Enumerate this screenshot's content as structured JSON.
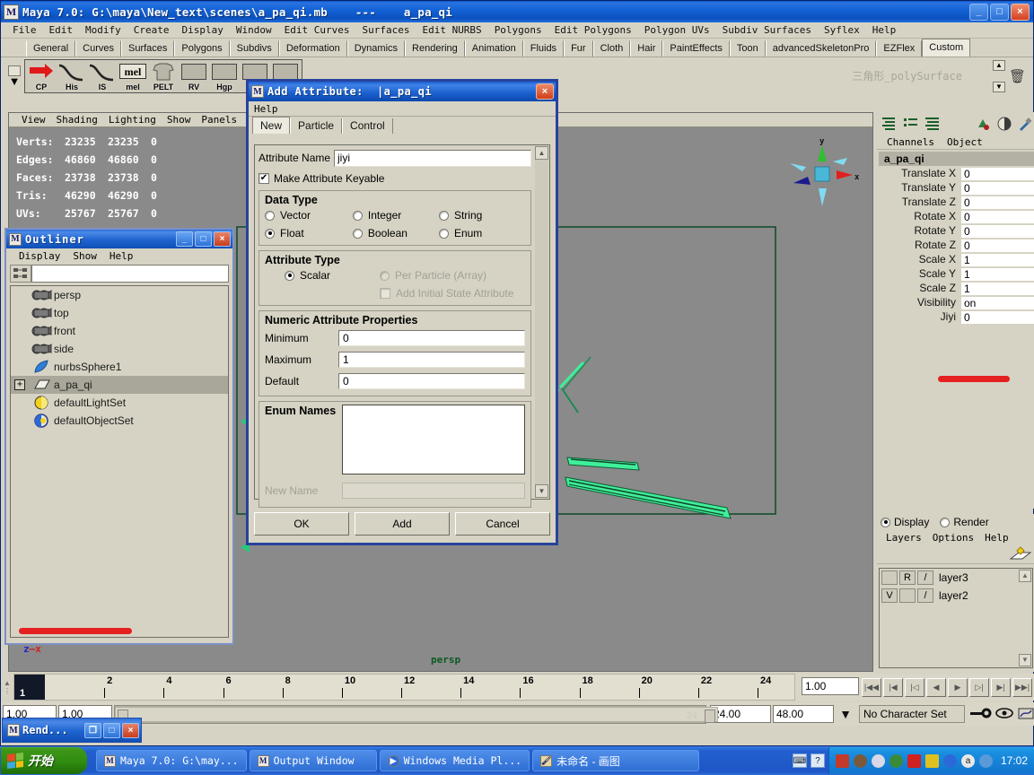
{
  "window": {
    "title": "Maya 7.0: G:\\maya\\New_text\\scenes\\a_pa_qi.mb    ---    a_pa_qi",
    "icon": "maya-m-icon",
    "minimize": "_",
    "maximize": "□",
    "close": "×"
  },
  "menubar": {
    "items": [
      "File",
      "Edit",
      "Modify",
      "Create",
      "Display",
      "Window",
      "Edit Curves",
      "Surfaces",
      "Edit NURBS",
      "Polygons",
      "Edit Polygons",
      "Polygon UVs",
      "Subdiv Surfaces",
      "Syflex",
      "Help"
    ]
  },
  "shelf": {
    "tabs": [
      "General",
      "Curves",
      "Surfaces",
      "Polygons",
      "Subdivs",
      "Deformation",
      "Dynamics",
      "Rendering",
      "Animation",
      "Fluids",
      "Fur",
      "Cloth",
      "Hair",
      "PaintEffects",
      "Toon",
      "advancedSkeletonPro",
      "EZFlex",
      "Custom"
    ],
    "active_tab": "Custom",
    "buttons": [
      {
        "label": "CP",
        "icon": "red-arrow-icon"
      },
      {
        "label": "His",
        "icon": "curve-icon"
      },
      {
        "label": "IS",
        "icon": "curve-icon"
      },
      {
        "label": "mel",
        "icon": "mel-script-icon"
      },
      {
        "label": "PELT",
        "icon": "shirt-icon"
      },
      {
        "label": "RV",
        "icon": "blank-icon"
      },
      {
        "label": "Hgp",
        "icon": "blank-icon"
      },
      {
        "label": "",
        "icon": "blank-icon"
      },
      {
        "label": "",
        "icon": "blank-icon"
      }
    ],
    "trash_icon": "trash-icon",
    "scroll_up": "▲",
    "scroll_down": "▼"
  },
  "viewport": {
    "menu": [
      "View",
      "Shading",
      "Lighting",
      "Show",
      "Panels"
    ],
    "camera_label": "persp",
    "axis_labels": {
      "x": "x",
      "y": "y",
      "z": "z"
    },
    "hud": {
      "rows": [
        {
          "label": "Verts:",
          "total": "23235",
          "selected": "23235",
          "extra": "0"
        },
        {
          "label": "Edges:",
          "total": "46860",
          "selected": "46860",
          "extra": "0"
        },
        {
          "label": "Faces:",
          "total": "23738",
          "selected": "23738",
          "extra": "0"
        },
        {
          "label": "Tris:",
          "total": "46290",
          "selected": "46290",
          "extra": "0"
        },
        {
          "label": "UVs:",
          "total": "25767",
          "selected": "25767",
          "extra": "0"
        }
      ]
    }
  },
  "outliner": {
    "title": "Outliner",
    "icon": "maya-m-icon",
    "minimize": "_",
    "maximize": "□",
    "close": "×",
    "menu": [
      "Display",
      "Show",
      "Help"
    ],
    "search_value": "",
    "items": [
      {
        "label": "persp",
        "icon": "camera-icon",
        "selected": false,
        "expandable": false
      },
      {
        "label": "top",
        "icon": "camera-icon",
        "selected": false,
        "expandable": false
      },
      {
        "label": "front",
        "icon": "camera-icon",
        "selected": false,
        "expandable": false
      },
      {
        "label": "side",
        "icon": "camera-icon",
        "selected": false,
        "expandable": false
      },
      {
        "label": "nurbsSphere1",
        "icon": "nurbs-surface-icon",
        "selected": false,
        "expandable": false
      },
      {
        "label": "a_pa_qi",
        "icon": "mesh-icon",
        "selected": true,
        "expandable": true,
        "expand_glyph": "+"
      },
      {
        "label": "defaultLightSet",
        "icon": "light-set-icon",
        "selected": false,
        "expandable": false
      },
      {
        "label": "defaultObjectSet",
        "icon": "object-set-icon",
        "selected": false,
        "expandable": false
      }
    ]
  },
  "channel_box": {
    "menu": [
      "Channels",
      "Object"
    ],
    "object_name": "a_pa_qi",
    "channels": [
      {
        "name": "Translate X",
        "value": "0"
      },
      {
        "name": "Translate Y",
        "value": "0"
      },
      {
        "name": "Translate Z",
        "value": "0"
      },
      {
        "name": "Rotate X",
        "value": "0"
      },
      {
        "name": "Rotate Y",
        "value": "0"
      },
      {
        "name": "Rotate Z",
        "value": "0"
      },
      {
        "name": "Scale X",
        "value": "1"
      },
      {
        "name": "Scale Y",
        "value": "1"
      },
      {
        "name": "Scale Z",
        "value": "1"
      },
      {
        "name": "Visibility",
        "value": "on"
      },
      {
        "name": "Jiyi",
        "value": "0"
      }
    ],
    "icons": [
      "channels-list-icon",
      "channels-bullets-icon",
      "channels-sorted-icon",
      "material-icon",
      "shading-icon",
      "eyedropper-icon"
    ],
    "highlight_color": "#e52020"
  },
  "layers": {
    "display_label": "Display",
    "render_label": "Render",
    "mode": "Display",
    "menu": [
      "Layers",
      "Options",
      "Help"
    ],
    "new_layer_icon": "new-layer-icon",
    "rows": [
      {
        "visible": "",
        "render": "R",
        "shade": "/",
        "name": "layer3"
      },
      {
        "visible": "V",
        "render": "",
        "shade": "/",
        "name": "layer2"
      }
    ]
  },
  "dialog": {
    "title": "Add Attribute:  |a_pa_qi",
    "icon": "maya-m-icon",
    "close": "×",
    "menu": [
      "Help"
    ],
    "tabs": [
      "New",
      "Particle",
      "Control"
    ],
    "active_tab": "New",
    "attribute_name_label": "Attribute Name",
    "attribute_name_value": "jiyi",
    "keyable_label": "Make Attribute Keyable",
    "keyable_checked": true,
    "data_type": {
      "title": "Data Type",
      "options": [
        {
          "label": "Vector",
          "selected": false,
          "disabled": false
        },
        {
          "label": "Integer",
          "selected": false,
          "disabled": false
        },
        {
          "label": "String",
          "selected": false,
          "disabled": false
        },
        {
          "label": "Float",
          "selected": true,
          "disabled": false
        },
        {
          "label": "Boolean",
          "selected": false,
          "disabled": false
        },
        {
          "label": "Enum",
          "selected": false,
          "disabled": false
        }
      ]
    },
    "attribute_type": {
      "title": "Attribute Type",
      "scalar": {
        "label": "Scalar",
        "selected": true,
        "disabled": false
      },
      "per_particle": {
        "label": "Per Particle (Array)",
        "selected": false,
        "disabled": true
      },
      "initial_state": {
        "label": "Add Initial State Attribute",
        "checked": false,
        "disabled": true
      }
    },
    "numeric": {
      "title": "Numeric Attribute Properties",
      "minimum_label": "Minimum",
      "minimum_value": "0",
      "maximum_label": "Maximum",
      "maximum_value": "1",
      "default_label": "Default",
      "default_value": "0"
    },
    "enum": {
      "title": "Enum Names",
      "list": [],
      "new_name_label": "New Name",
      "new_name_value": ""
    },
    "buttons": {
      "ok": "OK",
      "add": "Add",
      "cancel": "Cancel"
    },
    "scroll_up": "▲",
    "scroll_down": "▼"
  },
  "timeline": {
    "ticks": [
      2,
      4,
      6,
      8,
      10,
      12,
      14,
      16,
      18,
      20,
      22,
      24
    ],
    "current_frame": "1",
    "start_field": "1.00",
    "anim_start_field": "1.00",
    "current_time_field": "1.00",
    "range_end_field": "24.00",
    "anim_end_field": "48.00",
    "range_display": "24",
    "character_set": "No Character Set",
    "playback_buttons": [
      "go-to-start-icon",
      "step-back-key-icon",
      "step-back-frame-icon",
      "play-backwards-icon",
      "play-forwards-icon",
      "step-forward-frame-icon",
      "step-forward-key-icon",
      "go-to-end-icon"
    ],
    "key-icon": "key-icon",
    "auto-key-icon": "auto-key-icon"
  },
  "rend_window": {
    "title": "Rend...",
    "icon": "maya-m-icon",
    "restore": "❐",
    "maximize": "□",
    "close": "×"
  },
  "taskbar": {
    "start_label": "开始",
    "tasks": [
      {
        "label": "Maya 7.0: G:\\may...",
        "icon": "maya-m-icon"
      },
      {
        "label": "Output Window",
        "icon": "maya-m-icon"
      },
      {
        "label": "Windows Media Pl...",
        "icon": "media-player-icon"
      },
      {
        "label": "未命名 - 画图",
        "icon": "paint-icon"
      }
    ],
    "quick_launch": [
      "keyboard-icon",
      "help-icon"
    ],
    "tray_icons": [
      "network-icon",
      "volume-icon",
      "disc-icon",
      "antivirus-icon",
      "firewall-icon",
      "shield-icon",
      "info-icon",
      "ad-icon",
      "update-icon"
    ],
    "clock": "17:02"
  },
  "colors": {
    "title_blue": "#1464d8",
    "maya_bg": "#d6d3c4",
    "viewport_gray": "#8a8a8a",
    "selection_green": "#3ff09a",
    "annotation_red": "#e52020"
  }
}
